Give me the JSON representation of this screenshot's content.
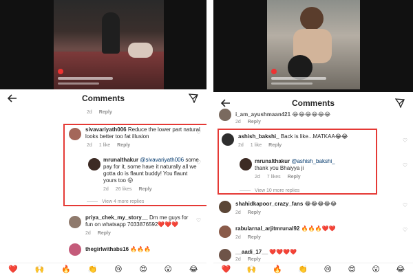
{
  "left": {
    "header": {
      "title": "Comments"
    },
    "top_meta": {
      "time": "2d",
      "reply": "Reply"
    },
    "c1": {
      "user": "sivavariyath006",
      "text": "Reduce the lower part natural looks better too fat illusion",
      "time": "2d",
      "likes": "1 like",
      "reply": "Reply"
    },
    "r1": {
      "user": "mrunalthakur",
      "mention": "@sivavariyath006",
      "text": "some pay for it, some have it naturally all we gotta do is flaunt buddy! You flaunt yours too 😛",
      "time": "2d",
      "likes": "26 likes",
      "reply": "Reply"
    },
    "view_more": "View 4 more replies",
    "c2": {
      "user": "priya_chek_my_story__",
      "text": "Dm me guys for fun on whatsapp 7033876592❤️❤️❤️",
      "time": "2d",
      "reply": "Reply"
    },
    "c3": {
      "user": "thegirlwithabs16",
      "text": "🔥🔥🔥"
    },
    "emoji_bar": [
      "❤️",
      "🙌",
      "🔥",
      "👏",
      "😢",
      "😍",
      "😮",
      "😂"
    ]
  },
  "right": {
    "header": {
      "title": "Comments"
    },
    "top": {
      "user": "i_am_ayushmaan421",
      "text": "😂😂😂😂😂😂",
      "time": "2d",
      "reply": "Reply"
    },
    "c1": {
      "user": "ashish_bakshi_",
      "text": "Back is like...MATKAA😂😂",
      "time": "2d",
      "likes": "1 like",
      "reply": "Reply"
    },
    "r1": {
      "user": "mrunalthakur",
      "mention": "@ashish_bakshi_",
      "text": "thank you Bhaiyya ji",
      "time": "2d",
      "likes": "7 likes",
      "reply": "Reply"
    },
    "view_more": "View 10 more replies",
    "c2": {
      "user": "shahidkapoor_crazy_fans",
      "text": "😂😂😂😂😂",
      "time": "2d",
      "reply": "Reply"
    },
    "c3": {
      "user": "rabularnal_arjitmrunal92",
      "text": "🔥🔥🔥❤️❤️",
      "time": "2d",
      "reply": "Reply"
    },
    "c4": {
      "user": "__aadi_17__",
      "text": "❤️❤️❤️❤️",
      "time": "2d",
      "reply": "Reply"
    },
    "emoji_bar": [
      "❤️",
      "🙌",
      "🔥",
      "👏",
      "😢",
      "😍",
      "😮",
      "😂"
    ]
  },
  "colors": {
    "highlight": "#e53935",
    "muted": "#8e8e8e"
  }
}
